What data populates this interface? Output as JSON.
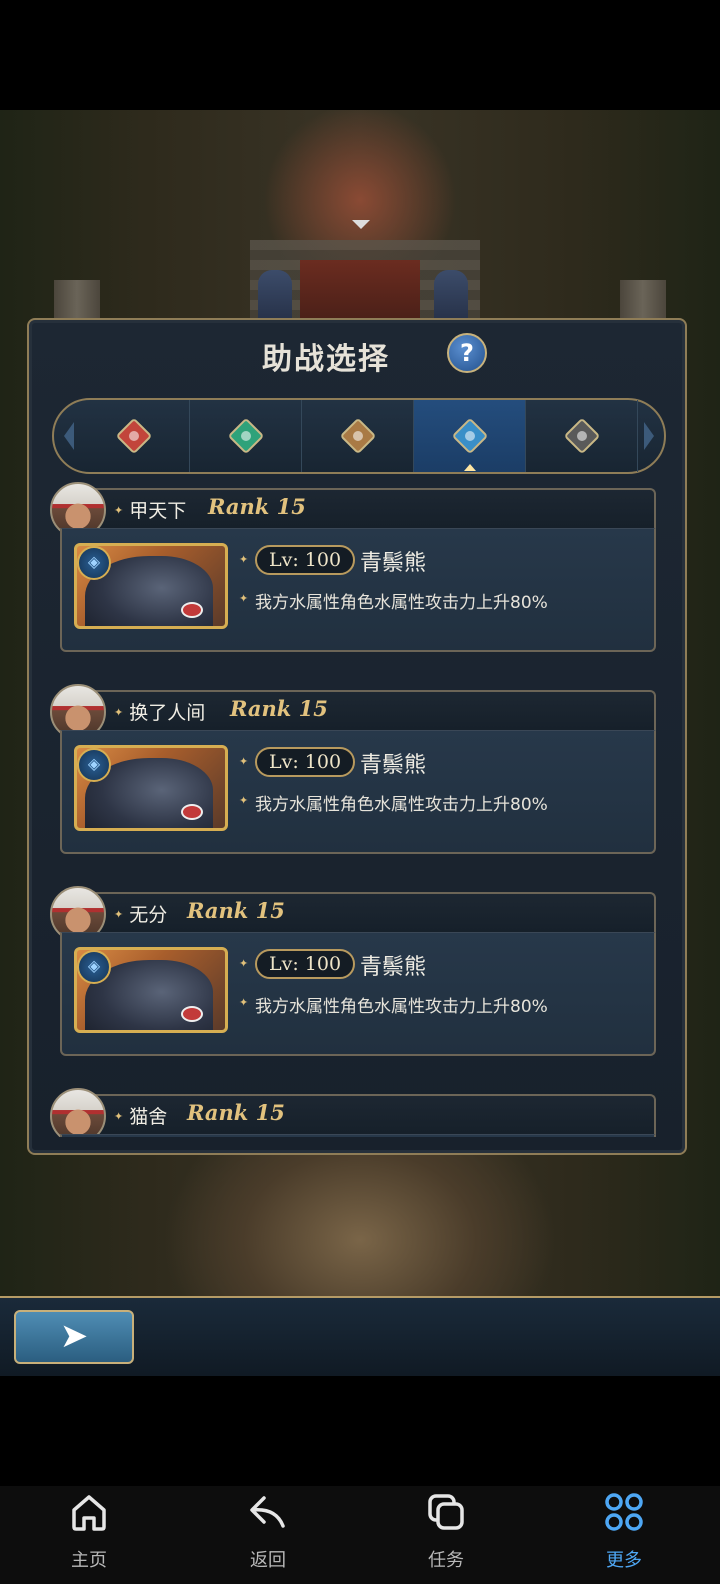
{
  "panel": {
    "title": "助战选择",
    "help_label": "?"
  },
  "tabs": [
    {
      "icon": "fire-element-icon",
      "color": "#c2453b",
      "active": false
    },
    {
      "icon": "wind-element-icon",
      "color": "#2fa27a",
      "active": false
    },
    {
      "icon": "earth-element-icon",
      "color": "#a97a45",
      "active": false
    },
    {
      "icon": "water-element-icon",
      "color": "#3a8fc8",
      "active": true
    },
    {
      "icon": "dark-element-icon",
      "color": "#5a5a5a",
      "active": false
    }
  ],
  "helpers": [
    {
      "name": "甲天下",
      "rank": "Rank 15",
      "level": "Lv: 100",
      "summon": "青鬃熊",
      "effect": "我方水属性角色水属性攻击力上升80%"
    },
    {
      "name": "换了人间",
      "rank": "Rank 15",
      "level": "Lv: 100",
      "summon": "青鬃熊",
      "effect": "我方水属性角色水属性攻击力上升80%"
    },
    {
      "name": "无分",
      "rank": "Rank 15",
      "level": "Lv: 100",
      "summon": "青鬃熊",
      "effect": "我方水属性角色水属性攻击力上升80%"
    },
    {
      "name": "猫舍",
      "rank": "Rank 15"
    }
  ],
  "game_back_button": {
    "icon": "back-arrow-icon"
  },
  "system_nav": [
    {
      "label": "主页",
      "icon": "home-icon",
      "active": false
    },
    {
      "label": "返回",
      "icon": "return-arrow-icon",
      "active": false
    },
    {
      "label": "任务",
      "icon": "tasks-icon",
      "active": false
    },
    {
      "label": "更多",
      "icon": "more-grid-icon",
      "active": true
    }
  ],
  "colors": {
    "accent": "#4ea7f4",
    "gold": "#e2c27e",
    "panel_border": "#8f7d57"
  }
}
